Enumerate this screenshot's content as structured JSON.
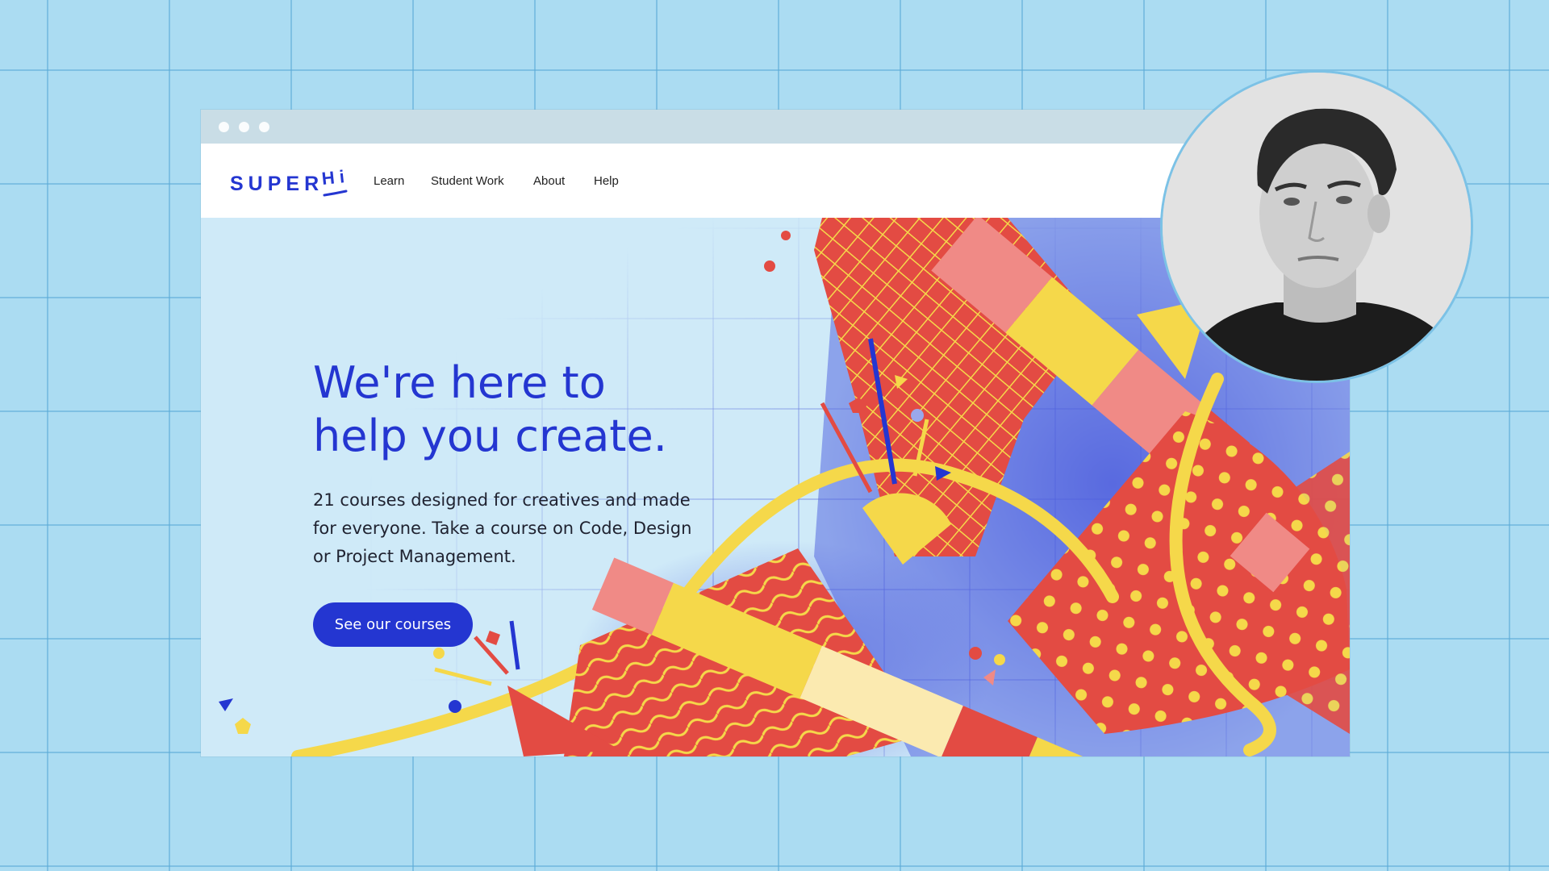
{
  "brand": {
    "logo_text": "SUPER",
    "logo_suffix": "Hi",
    "color": "#2436d1"
  },
  "nav": {
    "items": [
      {
        "label": "Learn"
      },
      {
        "label": "Student Work"
      },
      {
        "label": "About"
      },
      {
        "label": "Help"
      }
    ]
  },
  "hero": {
    "headline_line1": "We're here to",
    "headline_line2": "help you create.",
    "description": "21 courses designed for creatives and made for everyone. Take a course on Code, Design or Project Management.",
    "cta_label": "See our courses"
  },
  "colors": {
    "page_background": "#abdcf2",
    "hero_background": "#cfeaf8",
    "accent_blue": "#2436d1",
    "accent_red": "#e34b43",
    "accent_yellow": "#f5d84a",
    "accent_pink": "#f08a86"
  },
  "icons": {
    "window_dots": [
      "window-dot-icon",
      "window-dot-icon",
      "window-dot-icon"
    ],
    "avatar": "person-portrait"
  }
}
